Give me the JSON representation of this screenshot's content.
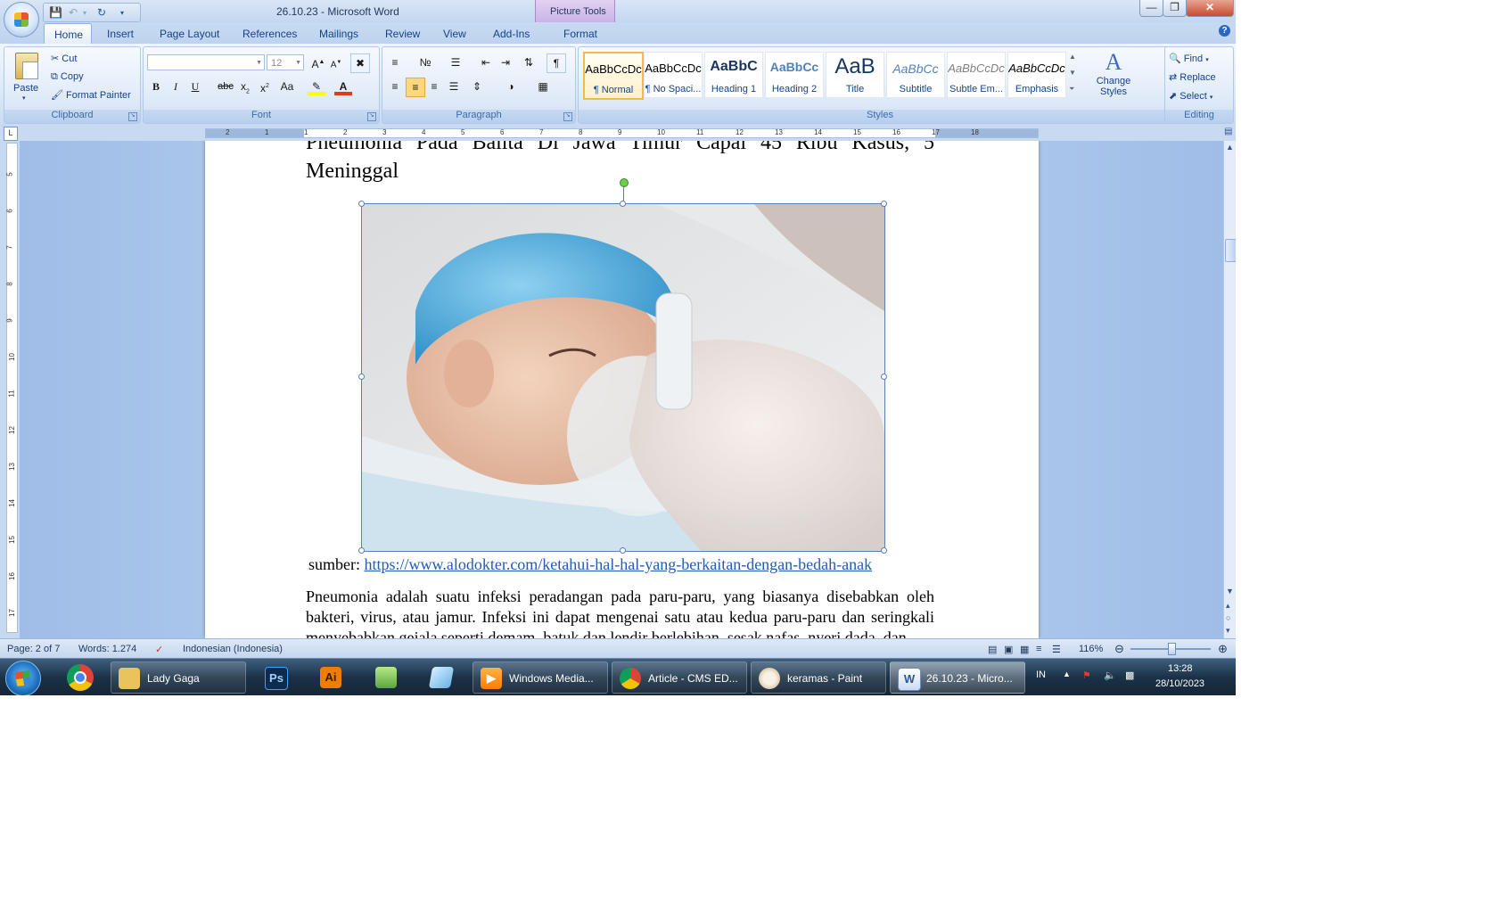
{
  "window": {
    "title": "26.10.23 - Microsoft Word",
    "context_tab_group": "Picture Tools"
  },
  "tabs": [
    "Home",
    "Insert",
    "Page Layout",
    "References",
    "Mailings",
    "Review",
    "View",
    "Add-Ins",
    "Format"
  ],
  "ribbon": {
    "clipboard": {
      "paste": "Paste",
      "cut": "Cut",
      "copy": "Copy",
      "format_painter": "Format Painter",
      "label": "Clipboard"
    },
    "font": {
      "font_name": "",
      "font_size": "12",
      "label": "Font"
    },
    "paragraph": {
      "label": "Paragraph"
    },
    "styles": {
      "label": "Styles",
      "items": [
        {
          "preview": "AaBbCcDc",
          "name": "¶ Normal"
        },
        {
          "preview": "AaBbCcDc",
          "name": "¶ No Spaci..."
        },
        {
          "preview": "AaBbC",
          "name": "Heading 1"
        },
        {
          "preview": "AaBbCc",
          "name": "Heading 2"
        },
        {
          "preview": "AaB",
          "name": "Title"
        },
        {
          "preview": "AaBbCc",
          "name": "Subtitle"
        },
        {
          "preview": "AaBbCcDc",
          "name": "Subtle Em..."
        },
        {
          "preview": "AaBbCcDc",
          "name": "Emphasis"
        }
      ],
      "change_styles": "Change Styles"
    },
    "editing": {
      "find": "Find",
      "replace": "Replace",
      "select": "Select",
      "label": "Editing"
    }
  },
  "ruler": {
    "marks": [
      "2",
      "1",
      "1",
      "2",
      "3",
      "4",
      "5",
      "6",
      "7",
      "8",
      "9",
      "10",
      "11",
      "12",
      "13",
      "14",
      "15",
      "16",
      "17",
      "18"
    ],
    "vmarks": [
      "5",
      "6",
      "7",
      "8",
      "9",
      "10",
      "11",
      "12",
      "13",
      "14",
      "15",
      "16",
      "17"
    ]
  },
  "document": {
    "heading": "Pneumonia Pada Balita Di Jawa Timur Capai 45 Ribu Kasus, 5 Meninggal",
    "caption_prefix": "sumber: ",
    "caption_link": "https://www.alodokter.com/ketahui-hal-hal-yang-berkaitan-dengan-bedah-anak",
    "paragraph": "Pneumonia adalah suatu infeksi peradangan pada paru-paru, yang biasanya disebabkan oleh bakteri, virus, atau jamur. Infeksi ini dapat mengenai satu atau kedua paru-paru dan seringkali menyebabkan gejala seperti demam, batuk dan lendir berlebihan, sesak nafas, nyeri dada, dan"
  },
  "statusbar": {
    "page": "Page: 2 of 7",
    "words": "Words: 1.274",
    "language": "Indonesian (Indonesia)",
    "zoom": "116%"
  },
  "taskbar": {
    "items": [
      {
        "label": "Lady Gaga",
        "icon": "folder-icon"
      },
      {
        "label": "Windows Media...",
        "icon": "media-player-icon"
      },
      {
        "label": "Article - CMS ED...",
        "icon": "chrome-icon"
      },
      {
        "label": "keramas - Paint",
        "icon": "paint-icon"
      },
      {
        "label": "26.10.23 - Micro...",
        "icon": "word-icon"
      }
    ],
    "pinned": [
      {
        "label": "Ps",
        "color": "#0d2b4e"
      },
      {
        "label": "Ai",
        "color": "#f07c00"
      }
    ],
    "language": "IN",
    "time": "13:28",
    "date": "28/10/2023"
  },
  "colors": {
    "accent": "#15428b",
    "link": "#1f5bb8",
    "selected_style": "#f5b84a"
  }
}
